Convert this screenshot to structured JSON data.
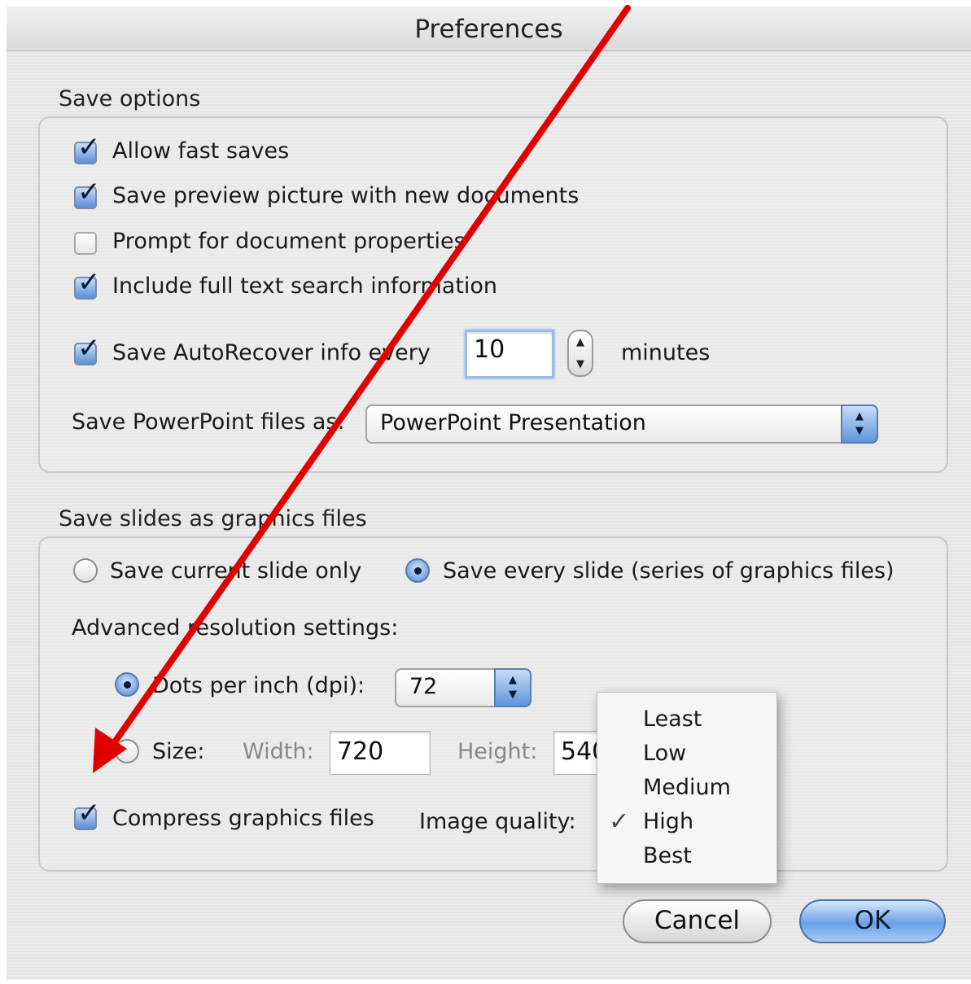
{
  "window": {
    "title": "Preferences"
  },
  "save_options": {
    "section_label": "Save options",
    "checkboxes": [
      {
        "label": "Allow fast saves",
        "checked": true
      },
      {
        "label": "Save preview picture with new documents",
        "checked": true
      },
      {
        "label": "Prompt for document properties",
        "checked": false
      },
      {
        "label": "Include full text search information",
        "checked": true
      }
    ],
    "autorecover": {
      "label": "Save AutoRecover info every",
      "checked": true,
      "value": "10",
      "unit": "minutes"
    },
    "file_format": {
      "label": "Save PowerPoint files as:",
      "selected": "PowerPoint Presentation"
    }
  },
  "graphics": {
    "section_label": "Save slides as graphics files",
    "radio_current": {
      "label": "Save current slide only",
      "selected": false
    },
    "radio_every": {
      "label": "Save every slide (series of graphics files)",
      "selected": true
    },
    "advanced_label": "Advanced resolution settings:",
    "dpi": {
      "label": "Dots per inch (dpi):",
      "selected": true,
      "value": "72"
    },
    "size": {
      "label": "Size:",
      "selected": false,
      "width_label": "Width:",
      "width_value": "720",
      "height_label": "Height:",
      "height_value": "540"
    },
    "compress": {
      "label": "Compress graphics files",
      "checked": true
    },
    "quality_label": "Image quality:",
    "quality_menu": {
      "options": [
        "Least",
        "Low",
        "Medium",
        "High",
        "Best"
      ],
      "selected": "High",
      "check_glyph": "✓"
    }
  },
  "buttons": {
    "cancel": "Cancel",
    "ok": "OK"
  },
  "annotation": {
    "arrow_color": "#e00000"
  }
}
